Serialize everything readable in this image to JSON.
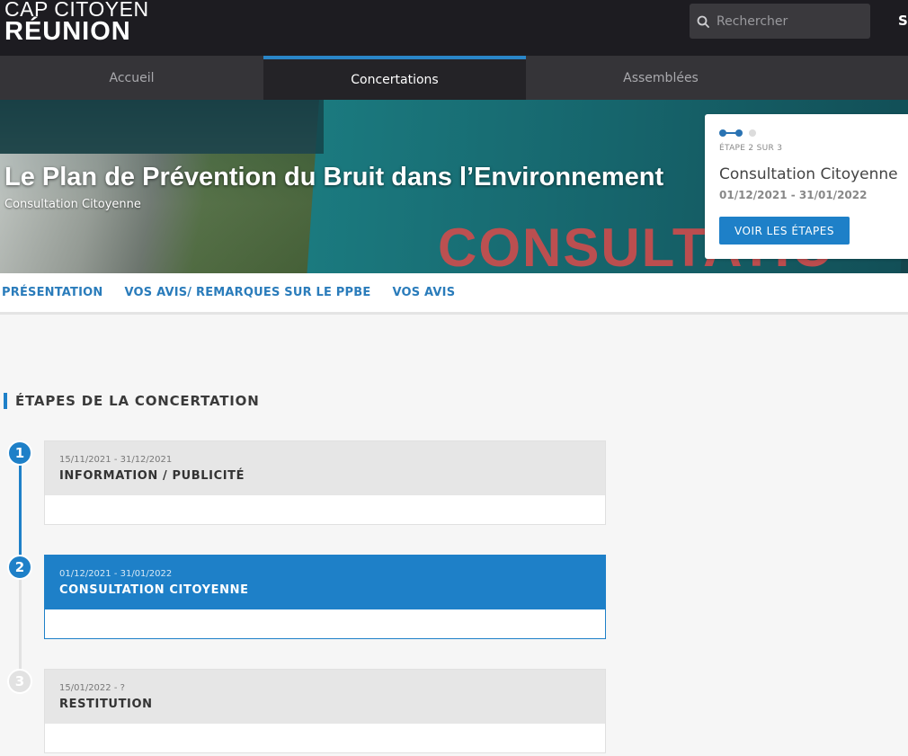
{
  "header": {
    "logo_line1": "CAP CITOYEN",
    "logo_line2": "RÉUNION",
    "search_placeholder": "Rechercher",
    "truncated_right": "S"
  },
  "nav": {
    "tabs": [
      {
        "label": "Accueil",
        "active": false
      },
      {
        "label": "Concertations",
        "active": true
      },
      {
        "label": "Assemblées",
        "active": false
      }
    ]
  },
  "hero": {
    "title": "Le Plan de Prévention du Bruit dans l’Environnement",
    "subtitle": "Consultation Citoyenne",
    "watermark": "CONSULTATIO"
  },
  "step_card": {
    "label": "ÉTAPE 2 SUR 3",
    "current_step": 2,
    "total_steps": 3,
    "name": "Consultation Citoyenne",
    "dates": "01/12/2021 - 31/01/2022",
    "button_label": "VOIR LES ÉTAPES"
  },
  "subnav": {
    "items": [
      "PRÉSENTATION",
      "VOS AVIS/ REMARQUES SUR LE PPBE",
      "VOS AVIS"
    ]
  },
  "section": {
    "title": "ÉTAPES DE LA CONCERTATION"
  },
  "steps": [
    {
      "number": "1",
      "dates": "15/11/2021 - 31/12/2021",
      "name": "INFORMATION / PUBLICITÉ",
      "state": "done"
    },
    {
      "number": "2",
      "dates": "01/12/2021 - 31/01/2022",
      "name": "CONSULTATION CITOYENNE",
      "state": "active"
    },
    {
      "number": "3",
      "dates": "15/01/2022 - ?",
      "name": "RESTITUTION",
      "state": "upcoming"
    }
  ],
  "colors": {
    "accent": "#1e80c8",
    "header_bg": "#1d1c21",
    "nav_bg": "#353438",
    "upcoming": "#e2e2e2"
  }
}
